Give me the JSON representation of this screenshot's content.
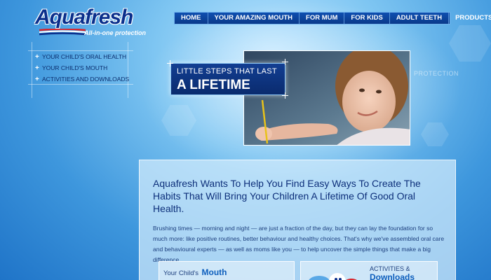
{
  "brand": {
    "logo_text": "Aquafresh",
    "tagline": "All-in-one protection",
    "colors": {
      "navy": "#0a2f8c",
      "red": "#d7262d",
      "sky": "#3e97dd",
      "link": "#0f5fbd"
    }
  },
  "top_nav": {
    "items": [
      {
        "label": "HOME"
      },
      {
        "label": "YOUR AMAZING MOUTH"
      },
      {
        "label": "FOR MUM"
      },
      {
        "label": "FOR KIDS"
      },
      {
        "label": "ADULT TEETH"
      },
      {
        "label": "PRODUCTS"
      }
    ]
  },
  "left_menu": {
    "items": [
      {
        "label": "YOUR CHILD'S ORAL HEALTH",
        "icon": "plus-icon"
      },
      {
        "label": "YOUR CHILD'S MOUTH",
        "icon": "plus-icon"
      },
      {
        "label": "ACTIVITIES AND DOWNLOADS",
        "icon": "plus-icon"
      }
    ]
  },
  "hero": {
    "line1": "LITTLE STEPS THAT LAST",
    "line2": "A LIFETIME",
    "side_text": "PROTECTION"
  },
  "content": {
    "heading": "Aquafresh Wants To Help You Find Easy Ways To Create The Habits That Will Bring Your Children A Lifetime Of Good Oral Health.",
    "body": "Brushing times — morning and night — are just a fraction of the day, but they can lay the foundation for so much more: like positive routines, better behaviour and healthy choices. That's why we've assembled oral care and behavioural experts — as well as moms like you — to help uncover the simple things that make a big difference.",
    "card_mouth": {
      "prefix": "Your Child's",
      "title": "Mouth"
    },
    "card_activities": {
      "prefix": "ACTIVITIES &",
      "title": "Downloads"
    }
  }
}
